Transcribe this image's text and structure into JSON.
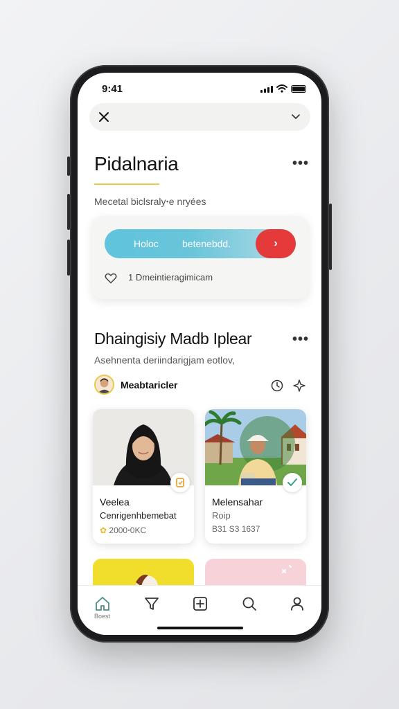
{
  "status_bar": {
    "time": "9:41"
  },
  "header": {
    "close_icon": "close-icon",
    "dropdown_icon": "chevron-down-icon"
  },
  "section1": {
    "title": "Pidalnaria",
    "more_icon": "more-horizontal-icon",
    "subtitle": "Mecetal biclsralyꞏe nryées",
    "card": {
      "pill_left_label": "Holoc",
      "pill_right_label": "betenebdd.",
      "pill_button_icon": "chevron-right-icon",
      "like_count": "1",
      "like_text": "Dmeintieragimicam"
    }
  },
  "section2": {
    "title": "Dhaingisiy Madb Iplear",
    "more_icon": "more-horizontal-icon",
    "subtitle": "Asehnenta deriindarigjam eotlov,",
    "author": "Meabtaricler",
    "clock_icon": "clock-icon",
    "star_icon": "sparkle-icon",
    "tiles": [
      {
        "name": "Veelea",
        "sub": "Cenrigenhbemebat",
        "meta": "2000ꞏ0KC",
        "badge_icon": "bookmark-icon"
      },
      {
        "name": "Melensahar",
        "sub": "Roip",
        "meta": "B31  S3 1637",
        "badge_icon": "check-icon"
      }
    ]
  },
  "tabbar": {
    "items": [
      {
        "icon": "home-icon",
        "label": "Boest"
      },
      {
        "icon": "filter-icon",
        "label": ""
      },
      {
        "icon": "add-square-icon",
        "label": ""
      },
      {
        "icon": "search-icon",
        "label": ""
      },
      {
        "icon": "profile-icon",
        "label": ""
      }
    ]
  },
  "colors": {
    "accent_yellow": "#e8c94a",
    "pill_blue": "#5fc4dd",
    "pill_red": "#e53a3a",
    "tile_yellow": "#f1de2c",
    "tile_pink": "#f7d3d9"
  }
}
